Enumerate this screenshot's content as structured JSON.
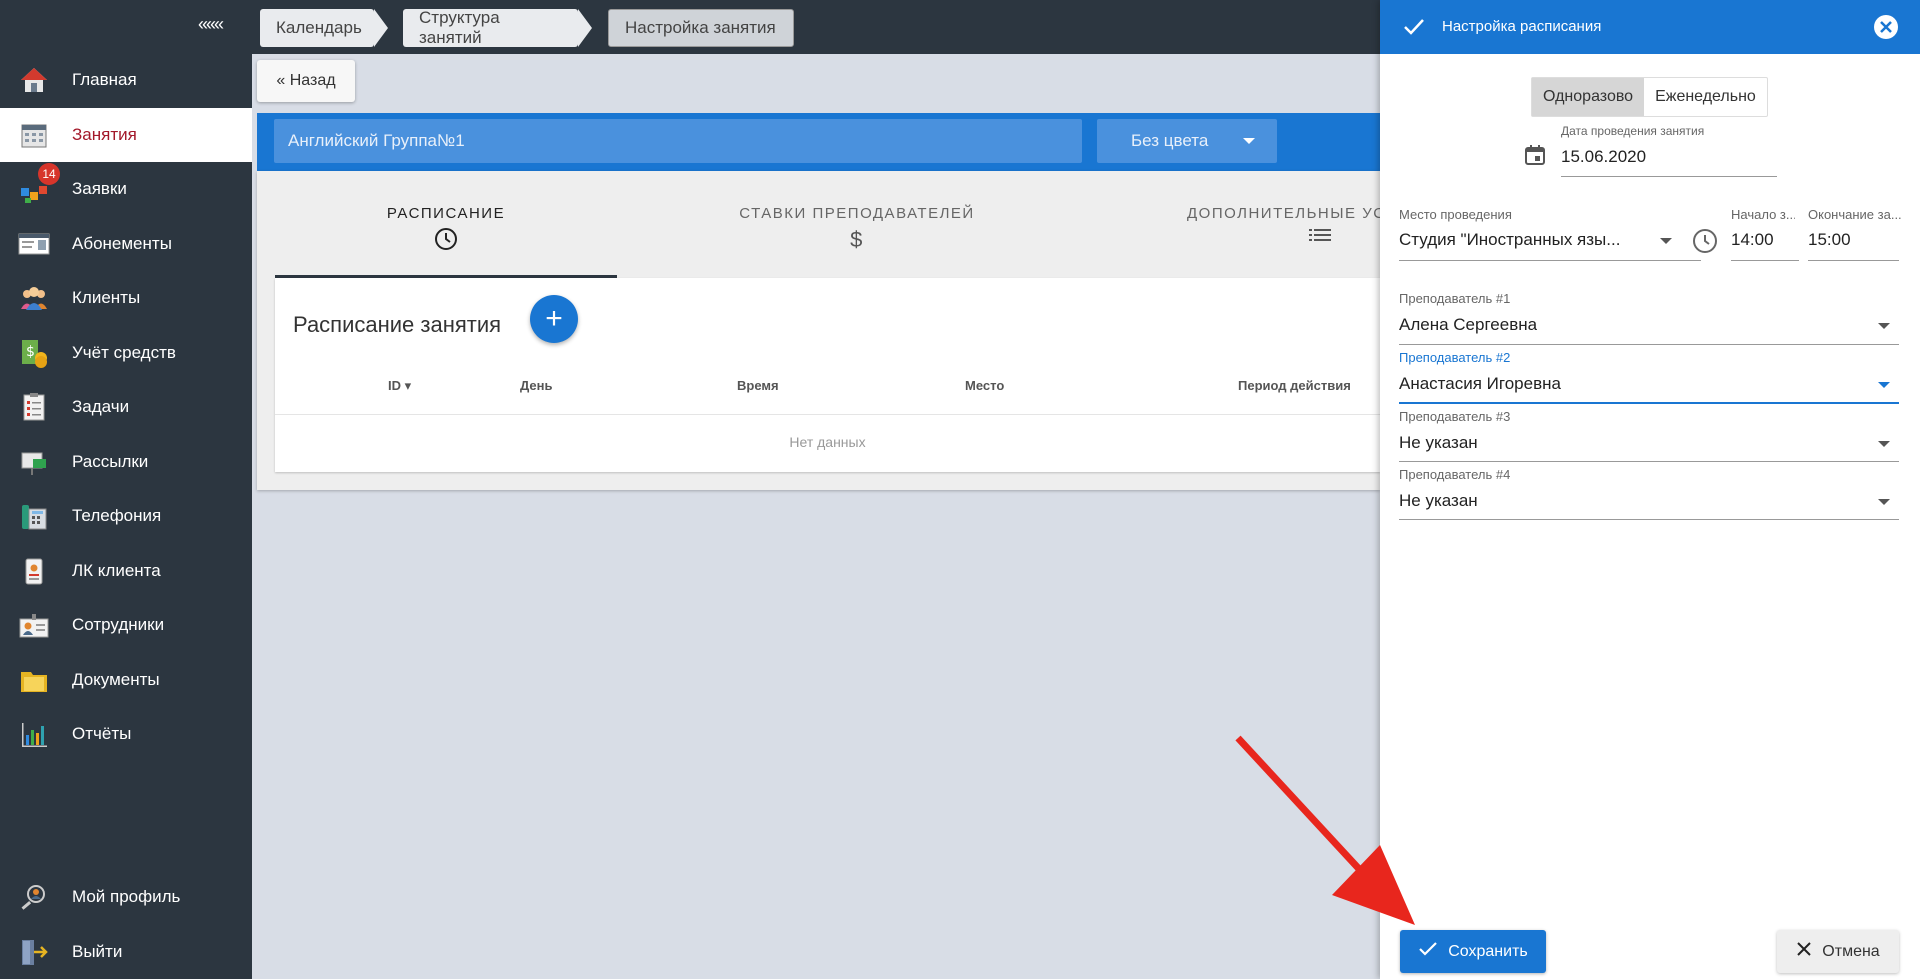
{
  "sidebar": {
    "collapse_label": "«««",
    "items": [
      {
        "label": "Главная",
        "icon": "home-icon"
      },
      {
        "label": "Занятия",
        "icon": "calendar-icon",
        "active": true
      },
      {
        "label": "Заявки",
        "icon": "requests-icon",
        "badge": "14"
      },
      {
        "label": "Абонементы",
        "icon": "subscription-card-icon"
      },
      {
        "label": "Клиенты",
        "icon": "clients-icon"
      },
      {
        "label": "Учёт средств",
        "icon": "money-icon"
      },
      {
        "label": "Задачи",
        "icon": "tasks-icon"
      },
      {
        "label": "Рассылки",
        "icon": "mailing-icon"
      },
      {
        "label": "Телефония",
        "icon": "phone-icon"
      },
      {
        "label": "ЛК клиента",
        "icon": "client-account-icon"
      },
      {
        "label": "Сотрудники",
        "icon": "employees-icon"
      },
      {
        "label": "Документы",
        "icon": "documents-icon"
      },
      {
        "label": "Отчёты",
        "icon": "reports-icon"
      }
    ],
    "bottom": [
      {
        "label": "Мой профиль",
        "icon": "profile-icon"
      },
      {
        "label": "Выйти",
        "icon": "logout-icon"
      }
    ]
  },
  "breadcrumbs": [
    "Календарь",
    "Структура занятий",
    "Настройка занятия"
  ],
  "main": {
    "back_label": "« Назад",
    "lesson_name": "Английский Группа№1",
    "color_select": "Без цвета",
    "tabs": [
      {
        "label": "РАСПИСАНИЕ",
        "icon": "clock-icon"
      },
      {
        "label": "СТАВКИ ПРЕПОДАВАТЕЛЕЙ",
        "icon": "dollar-icon"
      },
      {
        "label": "ДОПОЛНИТЕЛЬНЫЕ УС...",
        "icon": "list-icon"
      }
    ],
    "schedule_title": "Расписание занятия",
    "add_button": "+",
    "columns": [
      "ID",
      "День",
      "Время",
      "Место",
      "Период действия"
    ],
    "empty_text": "Нет данных"
  },
  "drawer": {
    "title": "Настройка расписания",
    "mode_options": [
      "Одноразово",
      "Еженедельно"
    ],
    "selected_mode": "Одноразово",
    "date_label": "Дата проведения занятия",
    "date_value": "15.06.2020",
    "place_label": "Место проведения",
    "place_value": "Студия \"Иностранных язы...",
    "start_label": "Начало з...",
    "start_value": "14:00",
    "end_label": "Окончание за...",
    "end_value": "15:00",
    "teachers": [
      {
        "label": "Преподаватель #1",
        "value": "Алена Сергеевна"
      },
      {
        "label": "Преподаватель #2",
        "value": "Анастасия Игоревна",
        "focused": true
      },
      {
        "label": "Преподаватель #3",
        "value": "Не указан"
      },
      {
        "label": "Преподаватель #4",
        "value": "Не указан"
      }
    ],
    "save_label": "Сохранить",
    "cancel_label": "Отмена"
  },
  "colors": {
    "sidebar_bg": "#2c3640",
    "accent_blue": "#1976d2",
    "active_nav_text": "#a3182a",
    "annotation_arrow": "#e8261d"
  }
}
